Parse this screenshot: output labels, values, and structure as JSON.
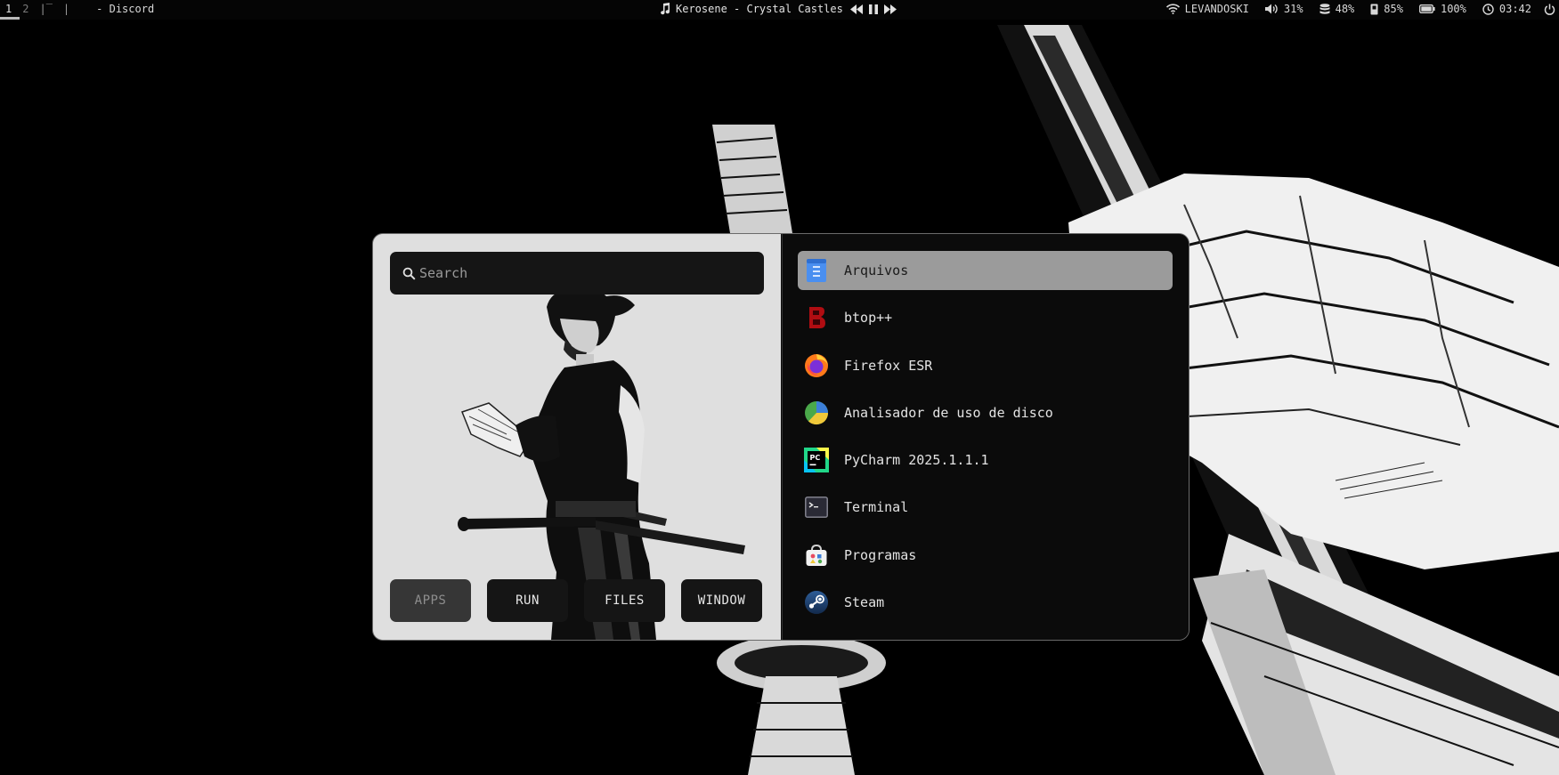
{
  "topbar": {
    "workspaces": [
      {
        "label": "1",
        "active": true
      },
      {
        "label": "2",
        "active": false
      }
    ],
    "workspace_glyph": "|‾",
    "separator": "|",
    "window_title": "- Discord",
    "media": {
      "track": "Kerosene - Crystal Castles"
    },
    "status": {
      "network": "LEVANDOSKI",
      "volume": "31%",
      "disk": "48%",
      "memory": "85%",
      "battery": "100%",
      "clock": "03:42"
    }
  },
  "launcher": {
    "search": {
      "placeholder": "Search",
      "value": ""
    },
    "modes": [
      {
        "label": "APPS",
        "active": true
      },
      {
        "label": "RUN",
        "active": false
      },
      {
        "label": "FILES",
        "active": false
      },
      {
        "label": "WINDOW",
        "active": false
      }
    ],
    "apps": [
      {
        "label": "Arquivos",
        "icon": "file-manager-icon",
        "selected": true
      },
      {
        "label": "btop++",
        "icon": "btop-icon",
        "selected": false
      },
      {
        "label": "Firefox ESR",
        "icon": "firefox-icon",
        "selected": false
      },
      {
        "label": "Analisador de uso de disco",
        "icon": "disk-usage-icon",
        "selected": false
      },
      {
        "label": "PyCharm 2025.1.1.1",
        "icon": "pycharm-icon",
        "selected": false
      },
      {
        "label": "Terminal",
        "icon": "terminal-icon",
        "selected": false
      },
      {
        "label": "Programas",
        "icon": "software-store-icon",
        "selected": false
      },
      {
        "label": "Steam",
        "icon": "steam-icon",
        "selected": false
      }
    ]
  },
  "colors": {
    "selected_bg": "#9b9b9b",
    "panel_bg": "#0b0b0b",
    "button_bg": "#151515",
    "button_active_bg": "#363636"
  }
}
